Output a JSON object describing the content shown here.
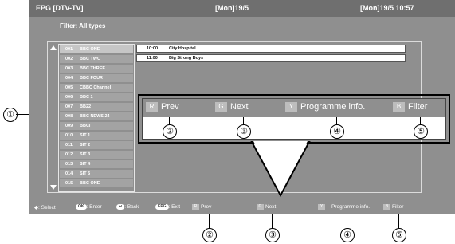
{
  "topbar": {
    "left": "EPG   [DTV-TV]",
    "center": "[Mon]19/5",
    "right": "[Mon]19/5   10:57"
  },
  "filter_label": "Filter: All types",
  "channels": [
    {
      "num": "001",
      "name": "BBC ONE"
    },
    {
      "num": "002",
      "name": "BBC TWO"
    },
    {
      "num": "003",
      "name": "BBC THREE"
    },
    {
      "num": "004",
      "name": "BBC FOUR"
    },
    {
      "num": "005",
      "name": "CBBC Channel"
    },
    {
      "num": "006",
      "name": "BBC 1"
    },
    {
      "num": "007",
      "name": "BB22"
    },
    {
      "num": "008",
      "name": "BBC NEWS 24"
    },
    {
      "num": "009",
      "name": "BBCi"
    },
    {
      "num": "010",
      "name": "SIT 1"
    },
    {
      "num": "011",
      "name": "SIT 2"
    },
    {
      "num": "012",
      "name": "SIT 3"
    },
    {
      "num": "013",
      "name": "SIT 4"
    },
    {
      "num": "014",
      "name": "SIT 5"
    },
    {
      "num": "015",
      "name": "BBC ONE"
    }
  ],
  "programmes": [
    {
      "time": "10:00",
      "title": "City Hospital"
    },
    {
      "time": "11:00",
      "title": "Big Strong Boys"
    }
  ],
  "footer": {
    "select": ": Select",
    "ok_key": "OK",
    "enter": ": Enter",
    "back_key": "↩",
    "back": ": Back",
    "epg_key": "EPG",
    "exit": ": Exit",
    "r_key": "R",
    "prev": "Prev",
    "g_key": "G",
    "next": "Next",
    "y_key": "Y",
    "programme_info": "Programme info.",
    "b_key": "B",
    "filter": "Filter"
  },
  "callout": {
    "r_key": "R",
    "prev": "Prev",
    "g_key": "G",
    "next": "Next",
    "y_key": "Y",
    "programme_info": "Programme info.",
    "b_key": "B",
    "filter": "Filter"
  },
  "annotations": {
    "n1": "①",
    "n2": "②",
    "n3": "③",
    "n4": "④",
    "n5": "⑤"
  },
  "colors": {
    "screen_bg": "#8f8f8f",
    "topbar_bg": "#6f6f6f",
    "row_bg": "#a3a3a3",
    "selected_row_bg": "#c6c6c6",
    "key_bg": "#bdbdbd"
  }
}
